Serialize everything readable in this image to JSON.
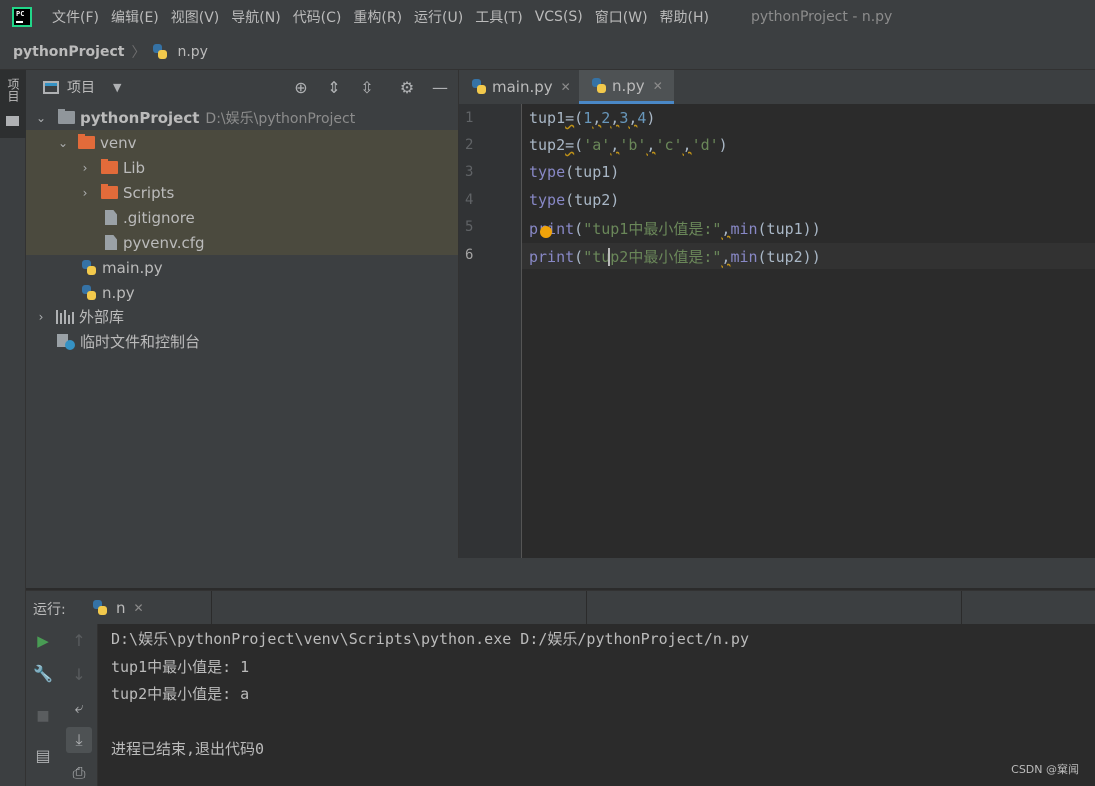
{
  "menubar": {
    "items": [
      "文件(F)",
      "编辑(E)",
      "视图(V)",
      "导航(N)",
      "代码(C)",
      "重构(R)",
      "运行(U)",
      "工具(T)",
      "VCS(S)",
      "窗口(W)",
      "帮助(H)"
    ],
    "window_title": "pythonProject - n.py"
  },
  "navbar": {
    "project": "pythonProject",
    "file": "n.py"
  },
  "stripe": {
    "project_label": "项目",
    "bottom_label": "树"
  },
  "project_panel": {
    "title": "项目",
    "tree": {
      "root": {
        "label": "pythonProject",
        "path": "D:\\娱乐\\pythonProject"
      },
      "venv": "venv",
      "lib": "Lib",
      "scripts": "Scripts",
      "gitignore": ".gitignore",
      "pyvenv": "pyvenv.cfg",
      "main": "main.py",
      "n": "n.py",
      "external_libs": "外部库",
      "scratches": "临时文件和控制台"
    }
  },
  "editor": {
    "tabs": [
      "main.py",
      "n.py"
    ],
    "active_tab": "n.py",
    "line_numbers": [
      "1",
      "2",
      "3",
      "4",
      "5",
      "6"
    ],
    "current_line": 6
  },
  "run": {
    "label": "运行:",
    "tab": "n",
    "output": [
      "D:\\娱乐\\pythonProject\\venv\\Scripts\\python.exe D:/娱乐/pythonProject/n.py",
      "tup1中最小值是: 1",
      "tup2中最小值是: a",
      "",
      "进程已结束,退出代码0"
    ]
  },
  "watermark": "CSDN @窠闻",
  "colors": {
    "accent": "#4a88c7",
    "run_green": "#499c54",
    "folder_orange": "#e26b3a",
    "highlight_row": "#4b4a3e"
  }
}
